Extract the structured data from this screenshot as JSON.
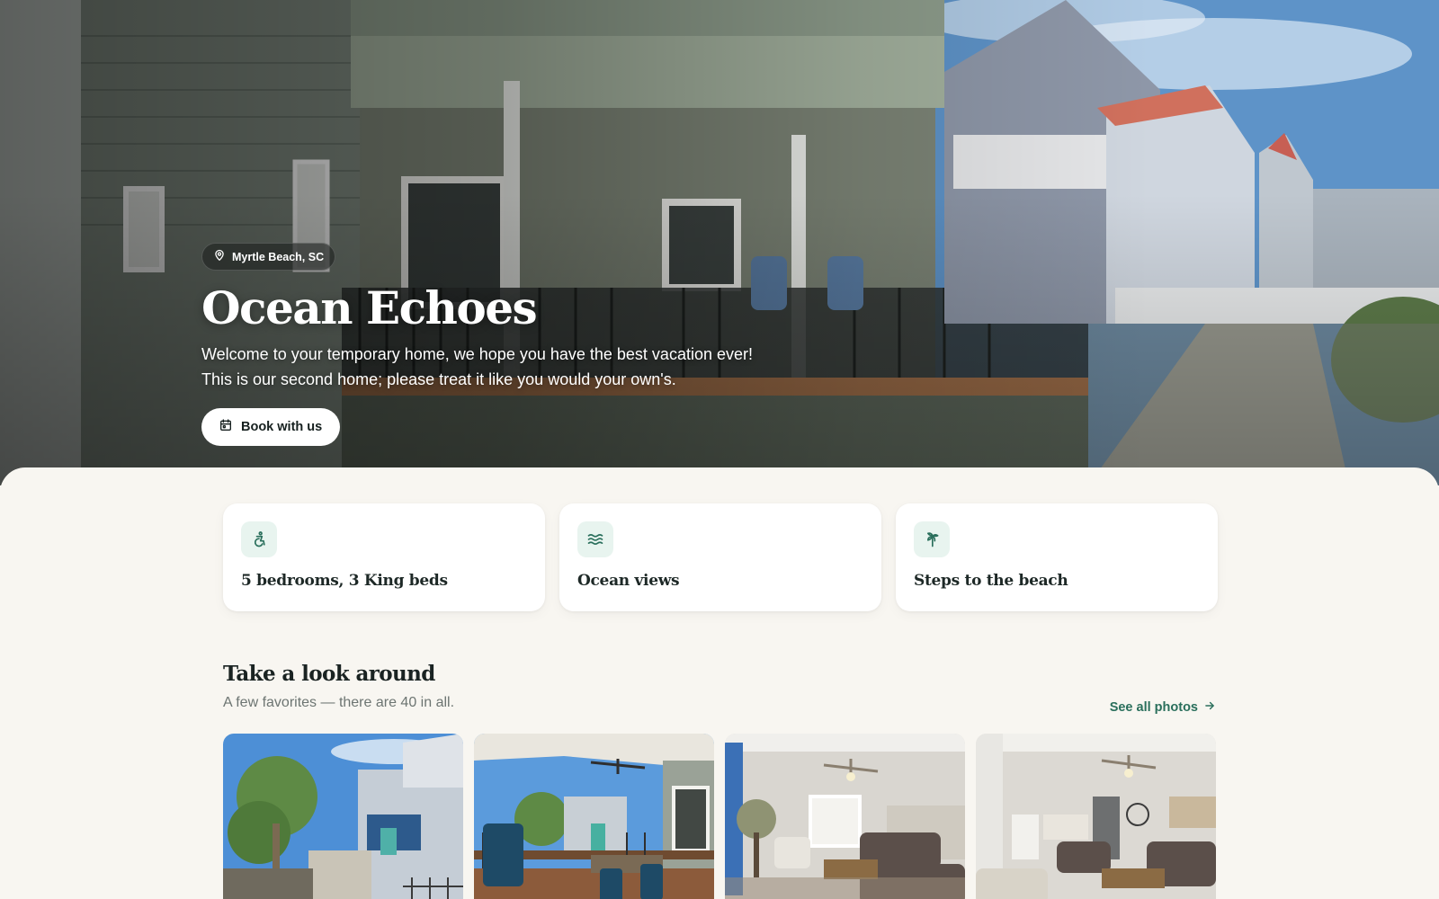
{
  "hero": {
    "location": "Myrtle Beach, SC",
    "title": "Ocean Echoes",
    "description_line1": "Welcome to your temporary home, we hope you have the best vacation ever!",
    "description_line2": "This is our second home; please treat it like you would your own's.",
    "book_label": "Book with us"
  },
  "features": [
    {
      "icon": "accessibility-icon",
      "label": "5 bedrooms, 3 King beds"
    },
    {
      "icon": "waves-icon",
      "label": "Ocean views"
    },
    {
      "icon": "palm-tree-icon",
      "label": "Steps to the beach"
    }
  ],
  "gallery": {
    "title": "Take a look around",
    "subtitle": "A few favorites — there are 40 in all.",
    "see_all_label": "See all photos",
    "photos": [
      {
        "subject": "street-view"
      },
      {
        "subject": "porch-deck"
      },
      {
        "subject": "living-room"
      },
      {
        "subject": "living-dining"
      }
    ]
  },
  "colors": {
    "accent": "#2a6f5c",
    "icon_bg": "#e8f4ef",
    "page_bg": "#f8f6f1"
  }
}
